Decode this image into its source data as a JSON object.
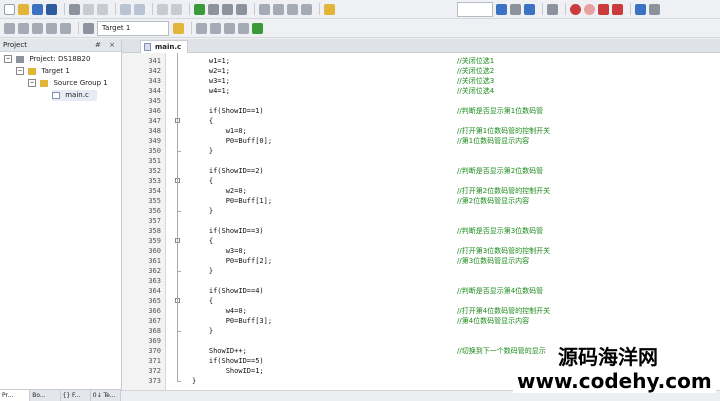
{
  "toolbar": {
    "target": "Target 1",
    "colors": {
      "icon_blue": "#3b72c4",
      "icon_green": "#3a9a3a",
      "icon_gray": "#8c939c",
      "icon_yellow": "#e3b43a",
      "icon_red": "#cc3b3b"
    }
  },
  "project_panel": {
    "title": "Project",
    "buttons": "# ×",
    "tree": [
      {
        "label": "Project: DS18B20",
        "icon": "project-icon"
      },
      {
        "label": "Target 1",
        "icon": "target-folder-icon"
      },
      {
        "label": "Source Group 1",
        "icon": "folder-icon"
      },
      {
        "label": "main.c",
        "icon": "c-file-icon"
      }
    ],
    "bottom_tabs": [
      "Pr...",
      "Bo...",
      "{} F...",
      "0↓ Te..."
    ]
  },
  "editor": {
    "tab_label": "main.c",
    "lines": [
      {
        "n": "341",
        "code": "    w1=1;",
        "comment": "//关闭位选1"
      },
      {
        "n": "342",
        "code": "    w2=1;",
        "comment": "//关闭位选2"
      },
      {
        "n": "343",
        "code": "    w3=1;",
        "comment": "//关闭位选3"
      },
      {
        "n": "344",
        "code": "    w4=1;",
        "comment": "//关闭位选4"
      },
      {
        "n": "345",
        "code": "",
        "comment": ""
      },
      {
        "n": "346",
        "code": "    if(ShowID==1)",
        "comment": "//判断是否显示第1位数码管"
      },
      {
        "n": "347",
        "code": "    {",
        "comment": ""
      },
      {
        "n": "348",
        "code": "        w1=0;",
        "comment": "//打开第1位数码管的控制开关"
      },
      {
        "n": "349",
        "code": "        P0=Buff[0];",
        "comment": "//第1位数码管显示内容"
      },
      {
        "n": "350",
        "code": "    }",
        "comment": ""
      },
      {
        "n": "351",
        "code": "",
        "comment": ""
      },
      {
        "n": "352",
        "code": "    if(ShowID==2)",
        "comment": "//判断是否显示第2位数码管"
      },
      {
        "n": "353",
        "code": "    {",
        "comment": ""
      },
      {
        "n": "354",
        "code": "        w2=0;",
        "comment": "//打开第2位数码管的控制开关"
      },
      {
        "n": "355",
        "code": "        P0=Buff[1];",
        "comment": "//第2位数码管显示内容"
      },
      {
        "n": "356",
        "code": "    }",
        "comment": ""
      },
      {
        "n": "357",
        "code": "",
        "comment": ""
      },
      {
        "n": "358",
        "code": "    if(ShowID==3)",
        "comment": "//判断是否显示第3位数码管"
      },
      {
        "n": "359",
        "code": "    {",
        "comment": ""
      },
      {
        "n": "360",
        "code": "        w3=0;",
        "comment": "//打开第3位数码管的控制开关"
      },
      {
        "n": "361",
        "code": "        P0=Buff[2];",
        "comment": "//第3位数码管显示内容"
      },
      {
        "n": "362",
        "code": "    }",
        "comment": ""
      },
      {
        "n": "363",
        "code": "",
        "comment": ""
      },
      {
        "n": "364",
        "code": "    if(ShowID==4)",
        "comment": "//判断是否显示第4位数码管"
      },
      {
        "n": "365",
        "code": "    {",
        "comment": ""
      },
      {
        "n": "366",
        "code": "        w4=0;",
        "comment": "//打开第4位数码管的控制开关"
      },
      {
        "n": "367",
        "code": "        P0=Buff[3];",
        "comment": "//第4位数码管显示内容"
      },
      {
        "n": "368",
        "code": "    }",
        "comment": ""
      },
      {
        "n": "369",
        "code": "",
        "comment": ""
      },
      {
        "n": "370",
        "code": "    ShowID++;",
        "comment": "//切换到下一个数码管的显示"
      },
      {
        "n": "371",
        "code": "    if(ShowID==5)",
        "comment": ""
      },
      {
        "n": "372",
        "code": "        ShowID=1;",
        "comment": ""
      },
      {
        "n": "373",
        "code": "}",
        "comment": ""
      }
    ]
  },
  "watermark": {
    "line1": "源码海洋网",
    "line2": "www.codehy.com"
  }
}
